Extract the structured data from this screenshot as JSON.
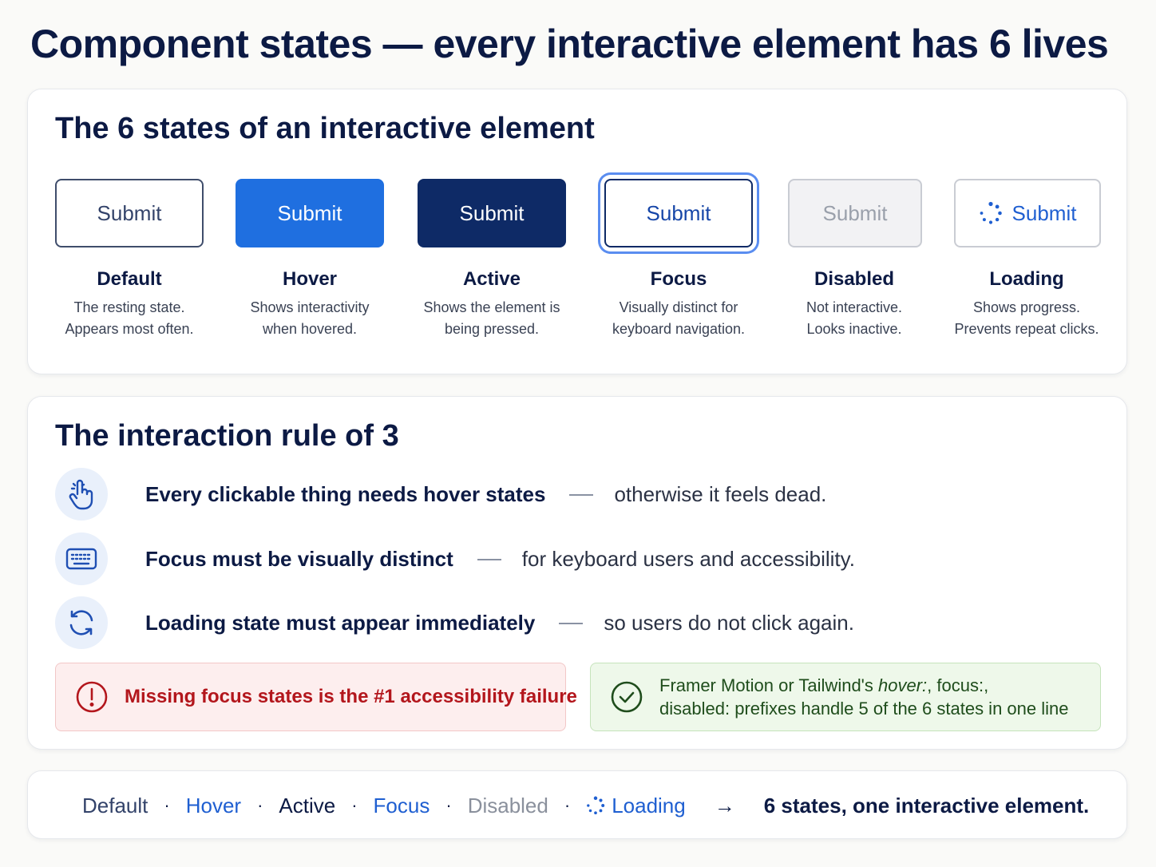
{
  "page_title": "Component states — every interactive element has 6 lives",
  "states_section": {
    "title": "The 6 states of an interactive element",
    "states": [
      {
        "button_label": "Submit",
        "name": "Default",
        "desc": [
          "The resting state.",
          "Appears most often."
        ]
      },
      {
        "button_label": "Submit",
        "name": "Hover",
        "desc": [
          "Shows interactivity",
          "when hovered."
        ]
      },
      {
        "button_label": "Submit",
        "name": "Active",
        "desc": [
          "Shows the element is",
          "being pressed."
        ]
      },
      {
        "button_label": "Submit",
        "name": "Focus",
        "desc": [
          "Visually distinct for",
          "keyboard navigation."
        ]
      },
      {
        "button_label": "Submit",
        "name": "Disabled",
        "desc": [
          "Not interactive.",
          "Looks inactive."
        ]
      },
      {
        "button_label": "Submit",
        "name": "Loading",
        "desc": [
          "Shows progress.",
          "Prevents repeat clicks."
        ]
      }
    ]
  },
  "rules_section": {
    "title": "The interaction rule of 3",
    "rules": [
      {
        "icon": "pointer-hand-icon",
        "strong": "Every clickable thing needs hover states",
        "soft": "otherwise it feels dead."
      },
      {
        "icon": "keyboard-icon",
        "strong": "Focus must be visually distinct",
        "soft": "for keyboard users and accessibility."
      },
      {
        "icon": "refresh-icon",
        "strong": "Loading state must appear immediately",
        "soft": "so users do not click again."
      }
    ],
    "warning": "Missing focus states is the #1 accessibility failure",
    "tip": {
      "part1": "Framer Motion or Tailwind's",
      "hover": "hover:",
      "comma": ",",
      "focus": "focus:,",
      "disabled": "disabled:",
      "part2": "prefixes handle 5 of the 6 states in one line"
    }
  },
  "footer": {
    "items": [
      "Default",
      "Hover",
      "Active",
      "Focus",
      "Disabled",
      "Loading"
    ],
    "dot": "·",
    "arrow": "→",
    "summary": "6 states, one interactive element."
  },
  "colors": {
    "accent": "#1f6fe0",
    "active": "#0e2a66",
    "warning": "#b3161c",
    "success": "#1f4d1c"
  }
}
